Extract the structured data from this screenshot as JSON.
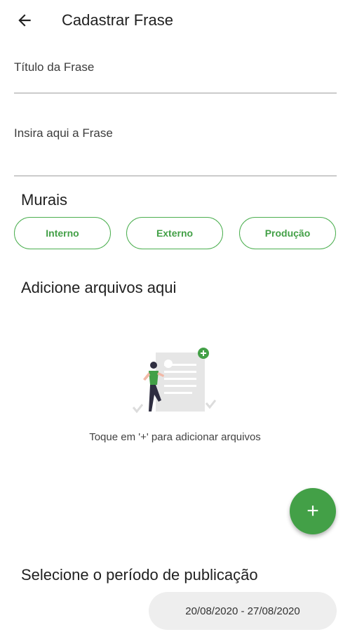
{
  "appbar": {
    "title": "Cadastrar Frase",
    "back_icon": "arrow-left-icon"
  },
  "form": {
    "title_placeholder": "Título da Frase",
    "phrase_placeholder": "Insira aqui a Frase"
  },
  "murais": {
    "heading": "Murais",
    "chips": [
      {
        "label": "Interno"
      },
      {
        "label": "Externo"
      },
      {
        "label": "Produção"
      }
    ]
  },
  "files": {
    "heading": "Adicione arquivos aqui",
    "empty_hint": "Toque em '+' para adicionar arquivos",
    "fab_label": "+"
  },
  "publication": {
    "heading": "Selecione o período de publicação",
    "range": "20/08/2020 - 27/08/2020"
  },
  "colors": {
    "accent": "#43a047",
    "chip_border": "#4caf50",
    "period_bg": "#eeeeee"
  }
}
